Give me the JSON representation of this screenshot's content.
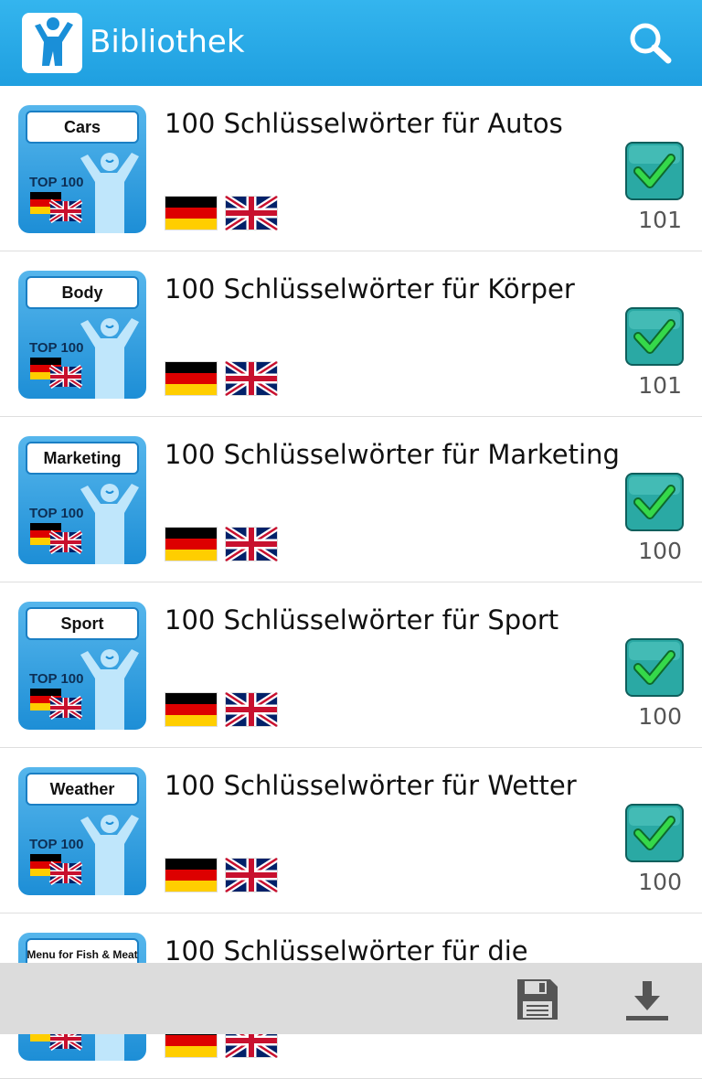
{
  "appbar": {
    "title": "Bibliothek",
    "icons": {
      "logo": "app-logo-icon",
      "search": "search-icon"
    },
    "colors": {
      "bar": "#1fa3e6",
      "text": "#ffffff"
    }
  },
  "badge": {
    "top100": "TOP 100",
    "flags": [
      "de-flag",
      "uk-flag"
    ]
  },
  "items": [
    {
      "thumb_label": "Cars",
      "title": "100 Schlüsselwörter für Autos",
      "count": "101",
      "checked": true
    },
    {
      "thumb_label": "Body",
      "title": "100 Schlüsselwörter für Körper",
      "count": "101",
      "checked": true
    },
    {
      "thumb_label": "Marketing",
      "title": "100 Schlüsselwörter für Marketing",
      "count": "100",
      "checked": true
    },
    {
      "thumb_label": "Sport",
      "title": "100 Schlüsselwörter für Sport",
      "count": "100",
      "checked": true
    },
    {
      "thumb_label": "Weather",
      "title": "100 Schlüsselwörter für Wetter",
      "count": "100",
      "checked": true
    },
    {
      "thumb_label": "Menu for Fish & Meat",
      "title": "100 Schlüsselwörter für die",
      "count": "",
      "checked": false
    }
  ],
  "bottombar": {
    "icons": {
      "save": "save-icon",
      "download": "download-icon"
    }
  }
}
